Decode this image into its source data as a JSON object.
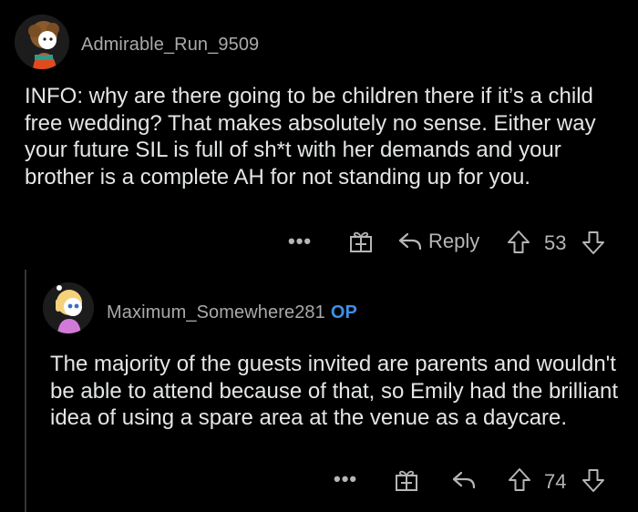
{
  "comment": {
    "author": "Admirable_Run_9509",
    "text": "INFO: why are there going to be children there if it’s a child free wedding? That makes absolutely no sense. Either way your future SIL is full of sh*t with her demands and your brother is a complete AH for not standing up for you.",
    "actions": {
      "more": "•••",
      "reply": "Reply",
      "score": "53"
    }
  },
  "reply": {
    "author": "Maximum_Somewhere281",
    "op_badge": "OP",
    "text": "The majority of the guests invited are parents and wouldn't be able to attend because of that, so Emily had the brilliant idea of using a spare area at the venue as a daycare.",
    "actions": {
      "more": "•••",
      "score": "74"
    }
  },
  "icons": {
    "award": "gift-award-icon",
    "reply": "reply-arrow-icon",
    "upvote": "upvote-arrow-icon",
    "downvote": "downvote-arrow-icon"
  },
  "colors": {
    "background": "#000000",
    "text": "#e3e5e6",
    "meta": "#a8aaab",
    "op": "#3f8fe6"
  }
}
